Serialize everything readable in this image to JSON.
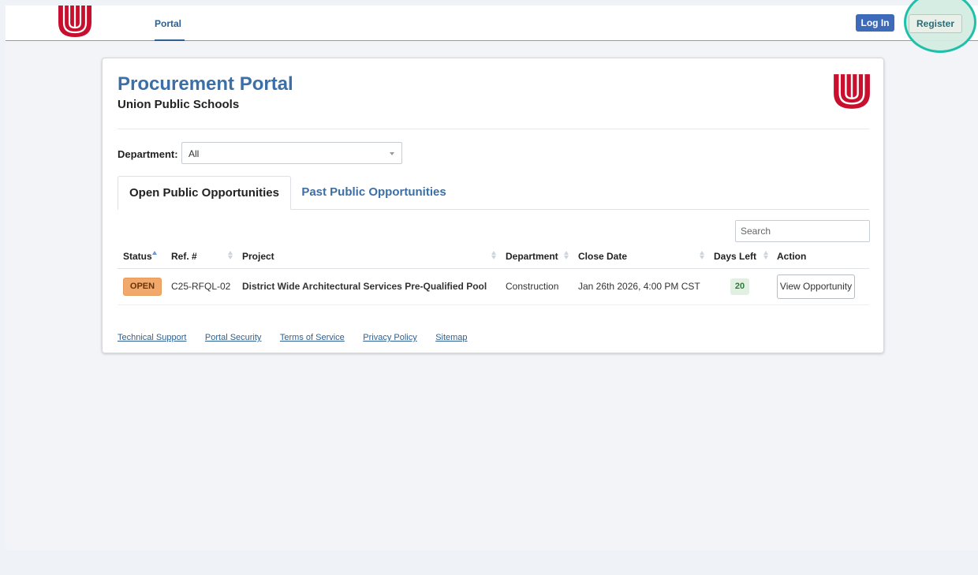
{
  "nav": {
    "tab_label": "Portal",
    "login_label": "Log In",
    "register_label": "Register"
  },
  "page": {
    "title": "Procurement Portal",
    "subtitle": "Union Public Schools"
  },
  "filter": {
    "label": "Department:",
    "selected": "All"
  },
  "tabs": [
    {
      "label": "Open Public Opportunities",
      "active": true
    },
    {
      "label": "Past Public Opportunities",
      "active": false
    }
  ],
  "search": {
    "placeholder": "Search"
  },
  "table": {
    "headers": [
      "Status",
      "Ref. #",
      "Project",
      "Department",
      "Close Date",
      "Days Left",
      "Action"
    ],
    "rows": [
      {
        "status": "OPEN",
        "ref": "C25-RFQL-02",
        "project": "District Wide Architectural Services Pre-Qualified Pool",
        "department": "Construction",
        "close_date": "Jan 26th 2026, 4:00 PM CST",
        "days_left": "20",
        "action": "View Opportunity"
      }
    ]
  },
  "footer": {
    "links": [
      "Technical Support",
      "Portal Security",
      "Terms of Service",
      "Privacy Policy",
      "Sitemap"
    ]
  },
  "colors": {
    "brand_red": "#c8102e",
    "link_blue": "#2d5f93",
    "title_blue": "#3b6fa5",
    "login_blue": "#3d6ab9",
    "highlight_teal": "#1fc0aa",
    "open_badge": "#f0a86c",
    "days_badge": "#e0f1e1"
  },
  "icons": {
    "logo": "union-u-logo",
    "sort": "sort-arrows-icon",
    "dropdown": "chevron-down-icon"
  }
}
